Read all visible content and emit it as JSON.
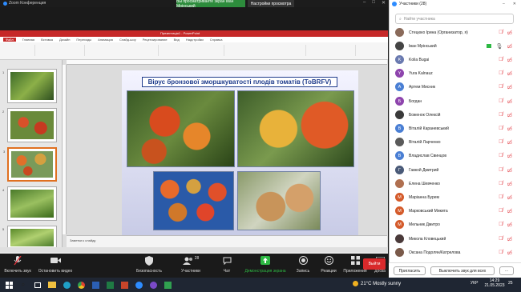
{
  "topbar": {
    "title": "Zoom Конференция",
    "share_banner": "Вы просматриваете экран Іван Мрінський",
    "view_options": "Настройки просмотра"
  },
  "ppt": {
    "caption": "Презентація1 - PowerPoint",
    "tabs": [
      "Файл",
      "Главная",
      "Вставка",
      "Дизайн",
      "Переходы",
      "Анимация",
      "Слайд-шоу",
      "Рецензирование",
      "Вид",
      "Надстройки",
      "Справка"
    ],
    "notes": "Заметки к слайду",
    "slide_title": "Вірус бронзової зморшкуватості плодів томатів (ToBRFV)",
    "thumb_numbers": [
      "1",
      "2",
      "3",
      "4",
      "5"
    ],
    "colors": {
      "ribbon": "#c62828",
      "title_border": "#1f3c8c"
    }
  },
  "controls": {
    "mic": "Включить звук",
    "video": "Остановить видео",
    "security": "Безопасность",
    "participants": "Участники",
    "participants_count": "28",
    "chat": "Чат",
    "share": "Демонстрация экрана",
    "record": "Запись",
    "reactions": "Реакции",
    "apps": "Приложения",
    "whiteboard": "Доска",
    "exit": "Выйти"
  },
  "panel": {
    "header": "Участники (28)",
    "search_placeholder": "Найти участника",
    "participants": [
      {
        "name": "Стецюко Ірина (Организатор, я)",
        "initial": "",
        "color": "#8a6a5a",
        "photo": true
      },
      {
        "name": "Іван Мрінський",
        "initial": "",
        "color": "#444",
        "photo": true,
        "active": true
      },
      {
        "name": "Kolia Bugai",
        "initial": "K",
        "color": "#6a7ab0"
      },
      {
        "name": "Yura Kalnauz",
        "initial": "Y",
        "color": "#8e44ad"
      },
      {
        "name": "Артем Мисник",
        "initial": "А",
        "color": "#4a7fd4"
      },
      {
        "name": "Богдан",
        "initial": "Б",
        "color": "#8e44ad"
      },
      {
        "name": "Боженок Олексій",
        "initial": "",
        "color": "#3a3a3a",
        "photo": true
      },
      {
        "name": "Віталій Караневський",
        "initial": "В",
        "color": "#4a7fd4"
      },
      {
        "name": "Віталій Ларченко",
        "initial": "",
        "color": "#5a5a5a",
        "photo": true
      },
      {
        "name": "Владислав Свинцов",
        "initial": "В",
        "color": "#4a7fd4"
      },
      {
        "name": "Гавкой Дмитрий",
        "initial": "Г",
        "color": "#4a5a78"
      },
      {
        "name": "Елена Шевченко",
        "initial": "",
        "color": "#b07050",
        "photo": true
      },
      {
        "name": "Маріанна Бурем",
        "initial": "М",
        "color": "#d45a2a"
      },
      {
        "name": "Марковський Микита",
        "initial": "М",
        "color": "#d45a2a"
      },
      {
        "name": "Мельник Дмитро",
        "initial": "М",
        "color": "#d45a2a"
      },
      {
        "name": "Микола Кловецький",
        "initial": "",
        "color": "#4a3a3a",
        "photo": true
      },
      {
        "name": "Оксана Подолян/Катрелова",
        "initial": "",
        "color": "#7a5a4a",
        "photo": true
      }
    ],
    "invite": "Пригласить",
    "mute_all": "Выключить звук для всех",
    "more": "···"
  },
  "taskbar": {
    "weather": "21°C Mostly sunny",
    "lang": "УКР",
    "time": "14:29",
    "date": "21.05.2023",
    "notif": "25"
  }
}
